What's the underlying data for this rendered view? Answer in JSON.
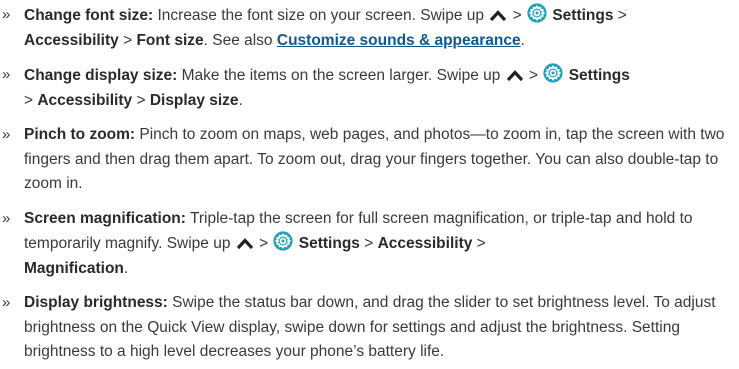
{
  "bullet": "»",
  "icons": {
    "swipe_up": "chevron-up-icon",
    "settings": "settings-gear-icon"
  },
  "colors": {
    "text": "#3a3a3a",
    "link": "#0f5a8c",
    "settings_icon": "#1aa3b8"
  },
  "items": [
    {
      "title": "Change font size:",
      "text1": " Increase the font size on your screen. Swipe up ",
      "gt1": " > ",
      "settings": " Settings",
      "gt2": " > ",
      "accessibility": "Accessibility",
      "gt3": " > ",
      "final": "Font size",
      "text2": ". See also ",
      "link": "Customize sounds & appearance",
      "text3": "."
    },
    {
      "title": "Change display size:",
      "text1": " Make the items on the screen larger. Swipe up ",
      "gt1": " > ",
      "settings": " Settings",
      "gt2": " > ",
      "accessibility": "Accessibility",
      "gt3": " > ",
      "final": "Display size",
      "text2": "."
    },
    {
      "title": "Pinch to zoom:",
      "text1": " Pinch to zoom on maps, web pages, and photos—to zoom in, tap the screen with two fingers and then drag them apart. To zoom out, drag your fingers together. You can also double-tap to zoom in."
    },
    {
      "title": "Screen magnification:",
      "text1": " Triple-tap the screen for full screen magnification, or triple-tap and hold to temporarily magnify. Swipe up ",
      "gt1": " > ",
      "settings": " Settings",
      "gt2": " > ",
      "accessibility": "Accessibility",
      "gt3": " > ",
      "final": "Magnification",
      "text2": "."
    },
    {
      "title": "Display brightness:",
      "text1": " Swipe the status bar down, and drag the slider to set brightness level. To adjust brightness on the Quick View display, swipe down for settings and adjust the brightness. Setting brightness to a high level decreases your phone’s battery life."
    }
  ]
}
